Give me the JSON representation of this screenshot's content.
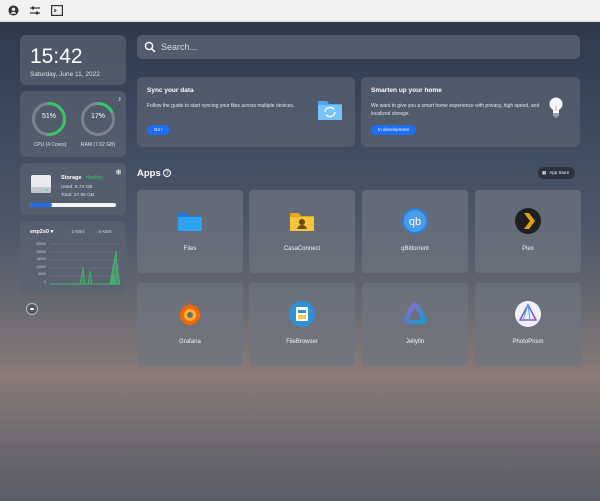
{
  "topbar": {
    "icons": [
      "user-circle-icon",
      "sliders-icon",
      "terminal-icon"
    ]
  },
  "clock": {
    "time": "15:42",
    "date": "Saturday, June 11, 2022"
  },
  "system": {
    "cpu": {
      "percent": 51,
      "percent_text": "51%",
      "label": "CPU (4 Cores)",
      "color": "#39c46b"
    },
    "ram": {
      "percent": 17,
      "percent_text": "17%",
      "label": "RAM (7.62 GB)",
      "color": "#39c46b"
    }
  },
  "storage": {
    "title": "Storage",
    "status": "Healthy",
    "status_color": "#3cc46a",
    "used": "Used: 6.74 GB",
    "total": "Total: 27.06 GB",
    "fraction": 0.25
  },
  "network": {
    "interface": "enp2s0",
    "upload": "2 KB/s",
    "download": "6 KB/s",
    "y_ticks": [
      "30000",
      "24000",
      "18000",
      "12000",
      "6000",
      "0"
    ]
  },
  "search": {
    "placeholder": "Search..."
  },
  "promos": [
    {
      "title": "Sync your data",
      "text": "Follow the guide to start syncing your files across multiple devices.",
      "button": "Go !"
    },
    {
      "title": "Smarten up your home",
      "text": "We want to give you a smart home experience with privacy, high speed, and localized storage.",
      "button": "In development"
    }
  ],
  "apps_section": {
    "title": "Apps",
    "app_store_label": "App Store"
  },
  "apps": [
    {
      "name": "Files"
    },
    {
      "name": "CasaConnect"
    },
    {
      "name": "qBittorrent"
    },
    {
      "name": "Plex"
    },
    {
      "name": "Grafana"
    },
    {
      "name": "FileBrowser"
    },
    {
      "name": "Jellyfin"
    },
    {
      "name": "PhotoPrism"
    }
  ]
}
